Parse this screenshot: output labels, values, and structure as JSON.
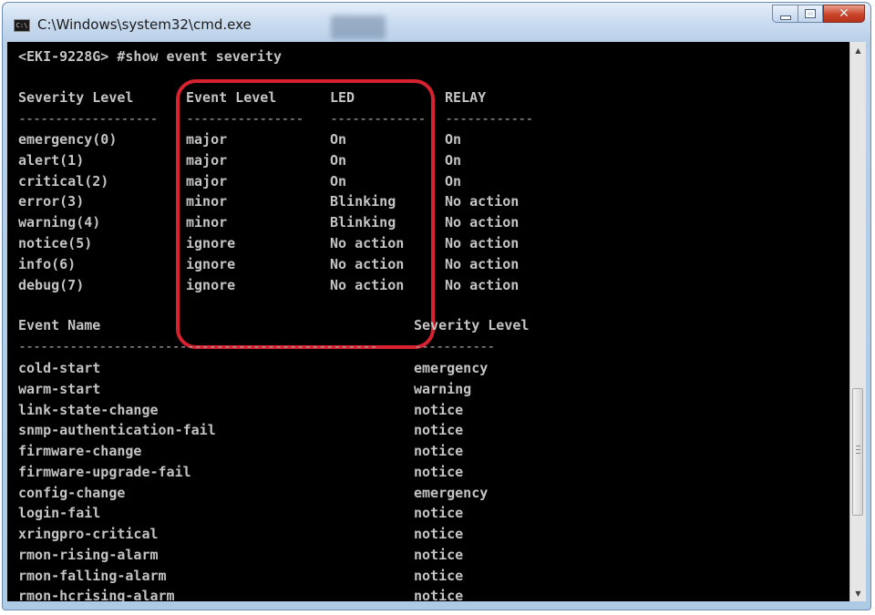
{
  "window": {
    "title": "C:\\Windows\\system32\\cmd.exe",
    "icon": "cmd-icon",
    "caption": {
      "minimize": "minimize-icon",
      "maximize": "maximize-icon",
      "close": "close-icon"
    }
  },
  "console": {
    "command": "<EKI-9228G> #show event severity",
    "severity_table": {
      "headers": [
        "Severity Level",
        "Event Level",
        "LED",
        "RELAY"
      ],
      "rows": [
        [
          "emergency(0)",
          "major",
          "On",
          "On"
        ],
        [
          "alert(1)",
          "major",
          "On",
          "On"
        ],
        [
          "critical(2)",
          "major",
          "On",
          "On"
        ],
        [
          "error(3)",
          "minor",
          "Blinking",
          "No action"
        ],
        [
          "warning(4)",
          "minor",
          "Blinking",
          "No action"
        ],
        [
          "notice(5)",
          "ignore",
          "No action",
          "No action"
        ],
        [
          "info(6)",
          "ignore",
          "No action",
          "No action"
        ],
        [
          "debug(7)",
          "ignore",
          "No action",
          "No action"
        ]
      ]
    },
    "event_table": {
      "headers": [
        "Event Name",
        "Severity Level"
      ],
      "rows": [
        [
          "cold-start",
          "emergency"
        ],
        [
          "warm-start",
          "warning"
        ],
        [
          "link-state-change",
          "notice"
        ],
        [
          "snmp-authentication-fail",
          "notice"
        ],
        [
          "firmware-change",
          "notice"
        ],
        [
          "firmware-upgrade-fail",
          "notice"
        ],
        [
          "config-change",
          "emergency"
        ],
        [
          "login-fail",
          "notice"
        ],
        [
          "xringpro-critical",
          "notice"
        ],
        [
          "rmon-rising-alarm",
          "notice"
        ],
        [
          "rmon-falling-alarm",
          "notice"
        ],
        [
          "rmon-hcrising-alarm",
          "notice"
        ]
      ]
    }
  },
  "colors": {
    "console_bg": "#000000",
    "console_text": "#c4c4c4",
    "highlight": "#d8222f"
  }
}
